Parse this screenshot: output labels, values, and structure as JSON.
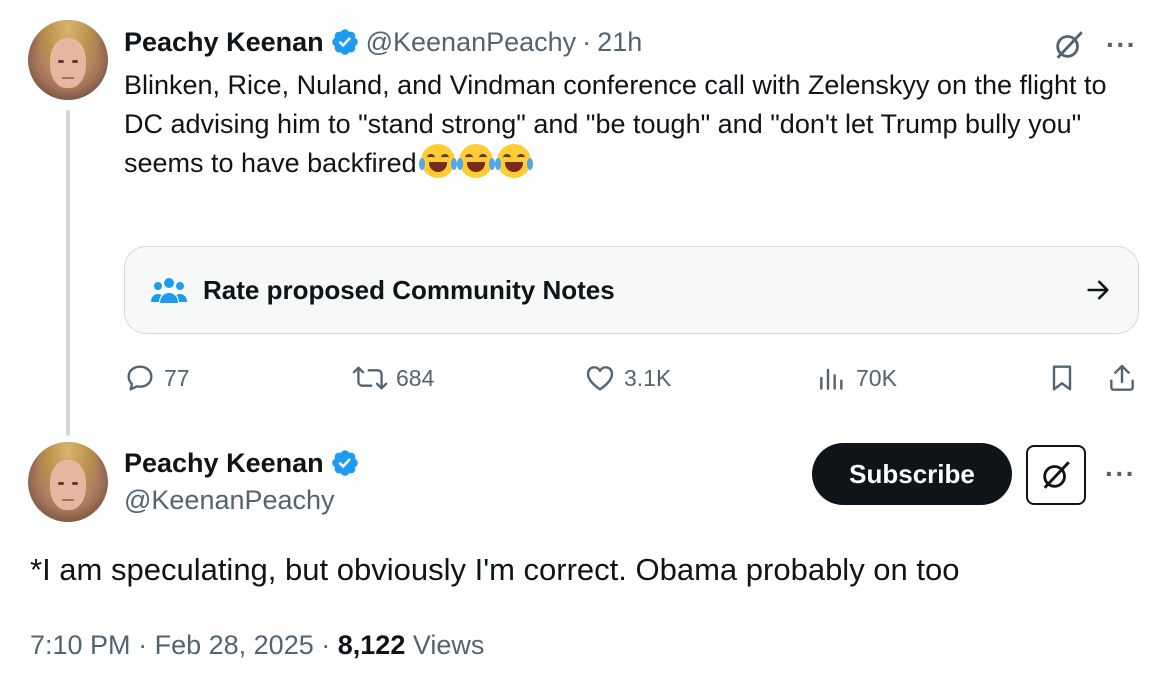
{
  "tweet1": {
    "author_name": "Peachy Keenan",
    "handle": "@KeenanPeachy",
    "separator": "·",
    "time": "21h",
    "body_lines": [
      "Blinken, Rice, Nuland, and Vindman conference call with Zelenskyy on the flight to DC advising him to \"stand strong\" and \"be tough\" and \"don't let Trump bully you\"",
      "seems to have backfired"
    ],
    "emoji": [
      "😂",
      "😂",
      "😂"
    ],
    "community_notes_label": "Rate proposed Community Notes",
    "actions": {
      "replies": "77",
      "reposts": "684",
      "likes": "3.1K",
      "views": "70K"
    }
  },
  "tweet2": {
    "author_name": "Peachy Keenan",
    "handle": "@KeenanPeachy",
    "subscribe_label": "Subscribe",
    "body": "*I am speculating, but obviously I'm correct. Obama probably on too",
    "time": "7:10 PM",
    "date": "Feb 28, 2025",
    "separator": "·",
    "views_count": "8,122",
    "views_label": "Views"
  },
  "colors": {
    "verified": "#1d9bf0",
    "text": "#0f1419",
    "secondary": "#536471",
    "notes_icon": "#1d9bf0"
  },
  "icons": {
    "verified": "verified-badge-icon",
    "grok": "grok-icon",
    "more": "more-icon",
    "notes": "community-notes-icon",
    "arrow": "arrow-right-icon",
    "reply": "reply-icon",
    "repost": "repost-icon",
    "like": "heart-icon",
    "views": "views-icon",
    "bookmark": "bookmark-icon",
    "share": "share-icon"
  }
}
